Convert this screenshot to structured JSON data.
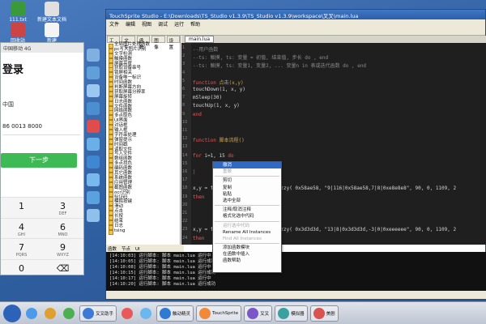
{
  "ide": {
    "title": "TouchSprite Studio - E:\\Downloads\\TS_Studio v1.3.9\\TS_Studio v1.3.9\\workspace\\叉叉\\main.lua",
    "menu": [
      "文件",
      "编辑",
      "视图",
      "调试",
      "运行",
      "帮助"
    ],
    "editor_tab": "main.lua",
    "tree_tabs": [
      "工程",
      "文件",
      "函数",
      "图像",
      "设置"
    ],
    "tree_items": [
      "全局图片处理函数",
      "pc写入图片识别",
      "文字检测",
      "触摸函数",
      "屏幕亮度",
      "获取设备串号",
      "锁屏相关",
      "设备唯一标识",
      "时间函数",
      "判断屏幕方向",
      "获取屏幕分辨率",
      "屏幕旋转",
      "日志函数",
      "文件函数",
      "网络函数",
      "多点取色",
      "UI界面",
      "对话框",
      "输入框",
      "字符串处理",
      "弹窗提示",
      "时间戳",
      "读取文件",
      "写入文件",
      "数组函数",
      "多点找色",
      "编码函数",
      "其它函数",
      "系统函数",
      "应用管理",
      "截图函数",
      "ocr识别",
      "验证码",
      "模拟按键",
      "滑动",
      "点击",
      "长按",
      "结束",
      "日志",
      "tsing"
    ],
    "tree_bottom_tabs": [
      "函数",
      "节点",
      "UI"
    ],
    "code_lines": [
      {
        "n": "1",
        "segs": [
          {
            "c": "c-comment",
            "t": "--用户函数"
          }
        ]
      },
      {
        "n": "2",
        "segs": [
          {
            "c": "c-comment",
            "t": "--ts: 触摸, ts: 变量 = 初值, 结束值, 步长 do , end"
          }
        ]
      },
      {
        "n": "3",
        "segs": [
          {
            "c": "c-comment",
            "t": "--ts: 触摸, ts: 变量1, 变量2, ... 变量n in 表或迭代函数 do , end"
          }
        ]
      },
      {
        "n": "4",
        "segs": []
      },
      {
        "n": "5",
        "segs": [
          {
            "c": "c-kw",
            "t": "function"
          },
          {
            "c": "c-fn",
            "t": " 点击(x,y)"
          }
        ]
      },
      {
        "n": "6",
        "segs": [
          {
            "c": "c-num",
            "t": "  touchDown(1, x, y)"
          }
        ]
      },
      {
        "n": "7",
        "segs": [
          {
            "c": "c-num",
            "t": "  mSleep(30)"
          }
        ]
      },
      {
        "n": "8",
        "segs": [
          {
            "c": "c-num",
            "t": "  touchUp(1, x, y)"
          }
        ]
      },
      {
        "n": "9",
        "segs": [
          {
            "c": "c-kw",
            "t": "end"
          }
        ]
      },
      {
        "n": "10",
        "segs": []
      },
      {
        "n": "11",
        "segs": []
      },
      {
        "n": "12",
        "segs": [
          {
            "c": "c-kw",
            "t": "function"
          },
          {
            "c": "c-fn",
            "t": " 脚本流程()"
          }
        ]
      },
      {
        "n": "13",
        "segs": []
      },
      {
        "n": "14",
        "segs": [
          {
            "c": "c-kw",
            "t": "for"
          },
          {
            "c": "c-num",
            "t": " i=1, 15 "
          },
          {
            "c": "c-kw",
            "t": "do"
          }
        ]
      },
      {
        "n": "15",
        "segs": []
      },
      {
        "n": "16",
        "segs": [
          {
            "c": "c-kw",
            "t": "  |"
          }
        ]
      },
      {
        "n": "17",
        "segs": []
      },
      {
        "n": "18",
        "segs": [
          {
            "c": "c-num",
            "t": "                              x,y = findMultiColorInRegionFuzzy( 0x58ae58, \"9|116|0x58ae58,7|8|0xe8e8e8\", 90, 0, 1109, 2"
          }
        ]
      },
      {
        "n": "19",
        "segs": [
          {
            "c": "c-kw",
            "t": "                              then"
          }
        ]
      },
      {
        "n": "20",
        "segs": []
      },
      {
        "n": "21",
        "segs": []
      },
      {
        "n": "22",
        "segs": []
      },
      {
        "n": "23",
        "segs": [
          {
            "c": "c-num",
            "t": "                              x,y = findMultiColorInRegionFuzzy( 0x3d3d3d, \"13|8|0x3d3d3d,-3|0|0xeeeeee\", 90, 0, 1109, 2"
          }
        ]
      },
      {
        "n": "24",
        "segs": [
          {
            "c": "c-kw",
            "t": "                              then"
          }
        ]
      }
    ],
    "output_lines": [
      "[14:10:03] 运行脚本: 脚本 main.lua 运行中",
      "[14:10:05] 运行脚本: 脚本 main.lua 运行成功",
      "[14:10:08] 运行脚本: 脚本 main.lua 运行中",
      "[14:10:15] 运行脚本: 脚本 main.lua 运行成功",
      "[14:10:17] 运行脚本: 脚本 main.lua 运行中",
      "[14:10:20] 运行脚本: 脚本 main.lua 运行成功"
    ]
  },
  "context_menu": [
    {
      "label": "撤消",
      "state": "hl"
    },
    {
      "label": "重做",
      "state": "dis"
    },
    {
      "sep": true
    },
    {
      "label": "剪切",
      "state": ""
    },
    {
      "label": "复制",
      "state": ""
    },
    {
      "label": "粘贴",
      "state": ""
    },
    {
      "label": "选中全部",
      "state": ""
    },
    {
      "sep": true
    },
    {
      "label": "注释/取消注释",
      "state": ""
    },
    {
      "label": "格式化选中代码",
      "state": ""
    },
    {
      "sep": true
    },
    {
      "label": "运行选中代码",
      "state": "dis"
    },
    {
      "label": "Rename All Instances",
      "state": ""
    },
    {
      "label": "Find All Instances",
      "state": "dis"
    },
    {
      "sep": true
    },
    {
      "label": "添加函数模块",
      "state": ""
    },
    {
      "label": "在函数中插入",
      "state": ""
    },
    {
      "label": "函数帮助",
      "state": ""
    }
  ],
  "phone": {
    "status": "中国移动 4G",
    "title": "登录",
    "region": "中国",
    "number": "86 0013 8000",
    "next_button": "下一步",
    "keys": [
      {
        "n": "1",
        "s": ""
      },
      {
        "n": "3",
        "s": "DEF"
      },
      {
        "n": "4",
        "s": "GHI"
      },
      {
        "n": "6",
        "s": "MNO"
      },
      {
        "n": "7",
        "s": "PQRS"
      },
      {
        "n": "9",
        "s": "WXYZ"
      },
      {
        "n": "0",
        "s": ""
      },
      {
        "n": "⌫",
        "s": ""
      }
    ]
  },
  "desktop_icons": [
    {
      "label": "111.txt"
    },
    {
      "label": "新建文本文档"
    },
    {
      "label": "回收站"
    },
    {
      "label": "新建"
    }
  ],
  "taskbar": {
    "items": [
      "",
      "",
      "",
      "叉叉助手",
      "",
      "",
      "触动精灵",
      "TouchSprite",
      "叉叉",
      "模拟器",
      "美剧"
    ]
  }
}
